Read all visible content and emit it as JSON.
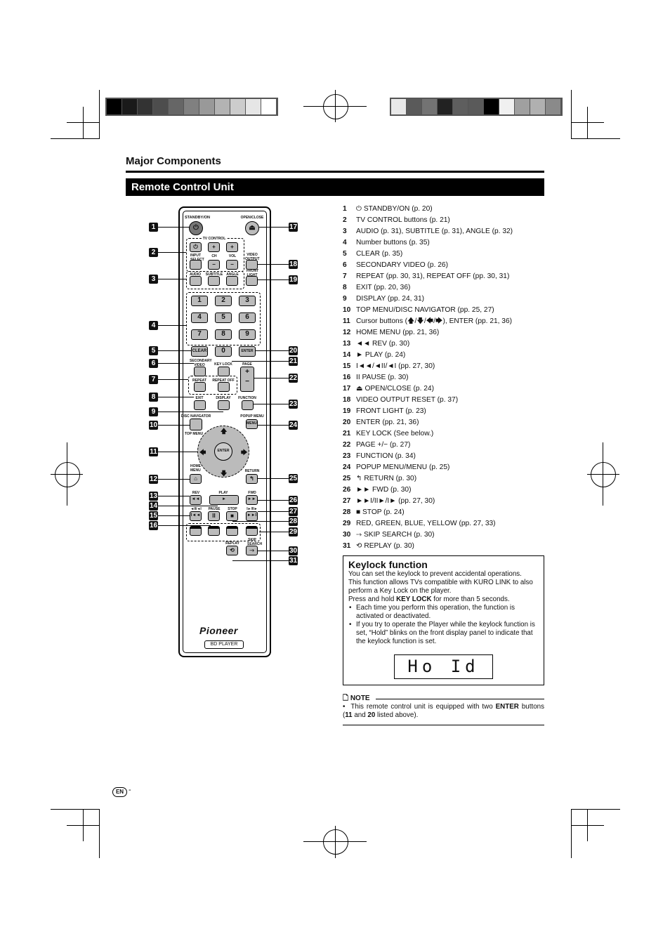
{
  "header": {
    "section_title": "Major Components",
    "banner_title": "Remote Control Unit"
  },
  "color_bars": {
    "left": [
      "#000000",
      "#1a1a1a",
      "#333333",
      "#4d4d4d",
      "#666666",
      "#808080",
      "#999999",
      "#b3b3b3",
      "#cccccc",
      "#e6e6e6",
      "#ffffff"
    ],
    "right": [
      "#e8e8e8",
      "#5a5a5a",
      "#737373",
      "#222222",
      "#5e5e5e",
      "#5a5a5a",
      "#000000",
      "#f0f0f0",
      "#a0a0a0",
      "#b0b0b0",
      "#8a8a8a"
    ]
  },
  "remote": {
    "labels": {
      "standby": "STANDBY/ON",
      "open_close": "OPEN/CLOSE",
      "tv_control": "TV CONTROL",
      "input_select": "INPUT SELECT",
      "ch": "CH",
      "vol": "VOL",
      "video_output_reset": "VIDEO OUTPUT RESET",
      "audio": "AUDIO",
      "subtitle": "SUBTITLE",
      "angle": "ANGLE",
      "front_light": "FRONT LIGHT",
      "clear": "CLEAR",
      "enter": "ENTER",
      "secondary_video": "SECONDARY VIDEO",
      "key_lock": "KEY LOCK",
      "page": "PAGE",
      "repeat": "REPEAT",
      "repeat_off": "REPEAT OFF",
      "exit": "EXIT",
      "display": "DISPLAY",
      "function": "FUNCTION",
      "disc_navigator": "DISC NAVIGATOR",
      "top_menu": "TOP MENU",
      "popup_menu": "POPUP MENU",
      "menu": "MENU",
      "home_menu": "HOME MENU",
      "return": "RETURN",
      "rev": "REV",
      "play": "PLAY",
      "fwd": "FWD",
      "step_back": "◄II/◄I",
      "pause": "PAUSE",
      "stop": "STOP",
      "step_fwd": "I►/II►",
      "replay": "REPLAY",
      "skip_search": "SKIP SEARCH",
      "brand": "Pioneer",
      "model": "BD PLAYER"
    },
    "number_keys": [
      "1",
      "2",
      "3",
      "4",
      "5",
      "6",
      "7",
      "8",
      "9",
      "0"
    ],
    "callouts_left": [
      "1",
      "2",
      "3",
      "4",
      "5",
      "6",
      "7",
      "8",
      "9",
      "10",
      "11",
      "12",
      "13",
      "14",
      "15",
      "16"
    ],
    "callouts_right": [
      "17",
      "18",
      "19",
      "20",
      "21",
      "22",
      "23",
      "24",
      "25",
      "26",
      "27",
      "28",
      "29",
      "30",
      "31"
    ]
  },
  "components": [
    {
      "n": "1",
      "text": "⏻ STANDBY/ON (p. 20)"
    },
    {
      "n": "2",
      "text": "TV CONTROL buttons (p. 21)"
    },
    {
      "n": "3",
      "text": "AUDIO (p. 31), SUBTITLE (p. 31), ANGLE (p. 32)"
    },
    {
      "n": "4",
      "text": "Number buttons (p. 35)"
    },
    {
      "n": "5",
      "text": "CLEAR (p. 35)"
    },
    {
      "n": "6",
      "text": "SECONDARY VIDEO (p. 26)"
    },
    {
      "n": "7",
      "text": "REPEAT (pp. 30, 31), REPEAT OFF (pp. 30, 31)"
    },
    {
      "n": "8",
      "text": "EXIT (pp. 20, 36)"
    },
    {
      "n": "9",
      "text": "DISPLAY (pp. 24, 31)"
    },
    {
      "n": "10",
      "text": "TOP MENU/DISC NAVIGATOR (pp. 25, 27)"
    },
    {
      "n": "11",
      "text": "Cursor buttons (🡅/🡇/🡄/🡆), ENTER (pp. 21, 36)"
    },
    {
      "n": "12",
      "text": "HOME MENU (pp. 21, 36)"
    },
    {
      "n": "13",
      "text": "◄◄ REV (p. 30)"
    },
    {
      "n": "14",
      "text": "► PLAY (p. 24)"
    },
    {
      "n": "15",
      "text": "I◄◄/◄II/◄I (pp. 27, 30)"
    },
    {
      "n": "16",
      "text": "II PAUSE (p. 30)"
    },
    {
      "n": "17",
      "text": "⏏ OPEN/CLOSE (p. 24)"
    },
    {
      "n": "18",
      "text": "VIDEO OUTPUT RESET (p. 37)"
    },
    {
      "n": "19",
      "text": "FRONT LIGHT (p. 23)"
    },
    {
      "n": "20",
      "text": "ENTER (pp. 21, 36)"
    },
    {
      "n": "21",
      "text": "KEY LOCK (See below.)"
    },
    {
      "n": "22",
      "text": "PAGE +/− (p. 27)"
    },
    {
      "n": "23",
      "text": "FUNCTION (p. 34)"
    },
    {
      "n": "24",
      "text": "POPUP MENU/MENU (p. 25)"
    },
    {
      "n": "25",
      "text": "↰ RETURN (p. 30)"
    },
    {
      "n": "26",
      "text": "►► FWD (p. 30)"
    },
    {
      "n": "27",
      "text": "►►I/II►/I► (pp. 27, 30)"
    },
    {
      "n": "28",
      "text": "■ STOP (p. 24)"
    },
    {
      "n": "29",
      "text": "RED, GREEN, BLUE, YELLOW (pp. 27, 33)"
    },
    {
      "n": "30",
      "text": "⤑ SKIP SEARCH (p. 30)"
    },
    {
      "n": "31",
      "text": "⟲ REPLAY (p. 30)"
    }
  ],
  "keylock": {
    "title": "Keylock function",
    "line1": "You can set the keylock to prevent accidental operations.",
    "line2": "This function allows TVs compatible with KURO LINK to also perform a Key Lock on the player.",
    "line3_pre": "Press and hold ",
    "line3_bold": "KEY LOCK",
    "line3_post": " for more than 5 seconds.",
    "bullets": [
      "Each time you perform this operation, the function is activated or deactivated.",
      "If you try to operate the Player while the keylock function is set, “Hold” blinks on the front display panel to indicate that the keylock function is set."
    ],
    "display_text": "Ho Id"
  },
  "note": {
    "heading": "NOTE",
    "pre": "This remote control unit is equipped with two ",
    "bold1": "ENTER",
    "mid1": " buttons (",
    "bold2": "11",
    "mid2": " and ",
    "bold3": "20",
    "post": " listed above)."
  },
  "footer": {
    "lang_badge": "EN",
    "page_suffix": "-"
  }
}
